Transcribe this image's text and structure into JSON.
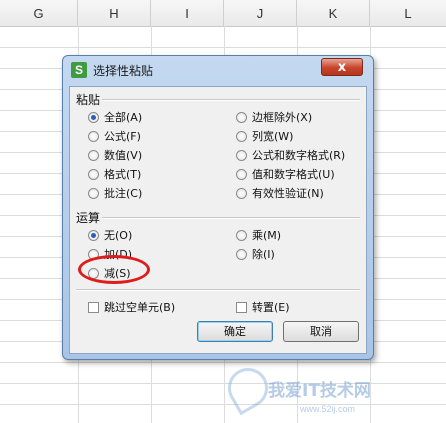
{
  "sheet": {
    "columns": [
      "G",
      "H",
      "I",
      "J",
      "K",
      "L"
    ]
  },
  "dialog": {
    "title": "选择性粘贴",
    "app_icon_letter": "S",
    "close_glyph": "x",
    "paste_section": {
      "label": "粘贴",
      "options": [
        {
          "label": "全部(A)",
          "selected": true
        },
        {
          "label": "边框除外(X)",
          "selected": false
        },
        {
          "label": "公式(F)",
          "selected": false
        },
        {
          "label": "列宽(W)",
          "selected": false
        },
        {
          "label": "数值(V)",
          "selected": false
        },
        {
          "label": "公式和数字格式(R)",
          "selected": false
        },
        {
          "label": "格式(T)",
          "selected": false
        },
        {
          "label": "值和数字格式(U)",
          "selected": false
        },
        {
          "label": "批注(C)",
          "selected": false
        },
        {
          "label": "有效性验证(N)",
          "selected": false
        }
      ]
    },
    "operation_section": {
      "label": "运算",
      "options": [
        {
          "label": "无(O)",
          "selected": true
        },
        {
          "label": "乘(M)",
          "selected": false
        },
        {
          "label": "加(D)",
          "selected": false
        },
        {
          "label": "除(I)",
          "selected": false
        },
        {
          "label": "减(S)",
          "selected": false
        }
      ]
    },
    "checkboxes": [
      {
        "label": "跳过空单元(B)",
        "checked": false
      },
      {
        "label": "转置(E)",
        "checked": false
      }
    ],
    "buttons": {
      "ok": "确定",
      "cancel": "取消"
    },
    "highlight_color": "#e01b1b"
  },
  "watermark": {
    "text": "我爱IT技术网",
    "url": "www.52ij.com"
  }
}
